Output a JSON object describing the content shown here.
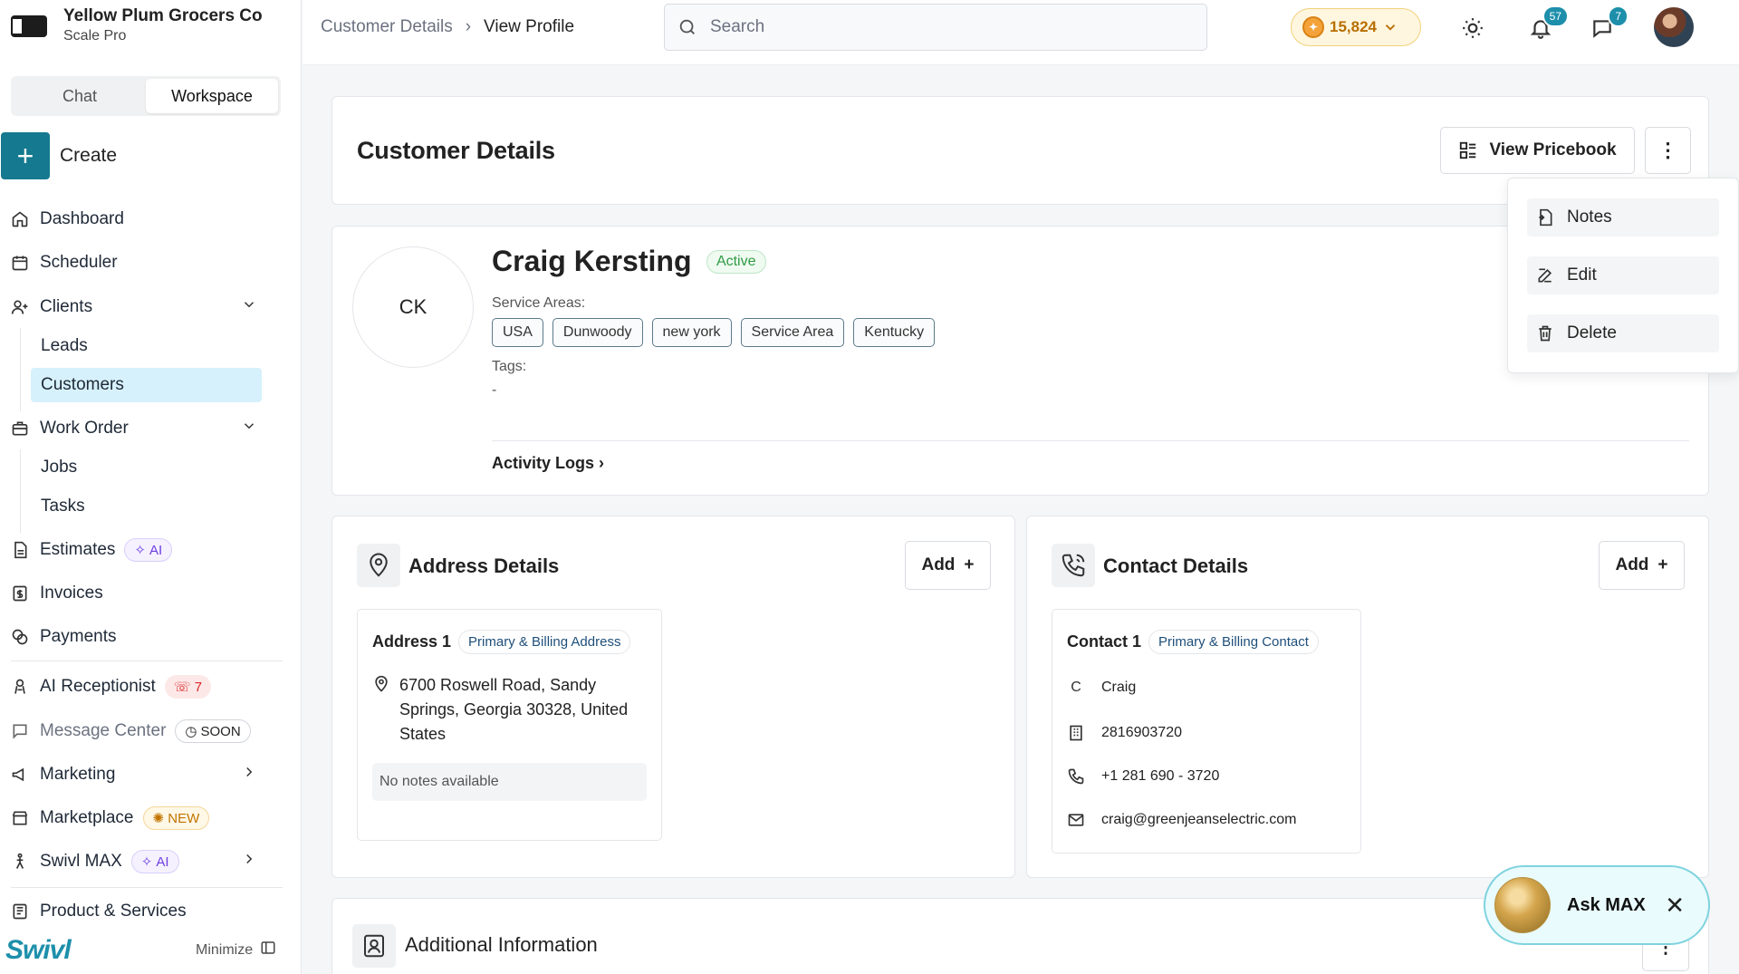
{
  "brand": {
    "name": "Yellow Plum Grocers Co",
    "plan": "Scale Pro"
  },
  "toggle": {
    "chat": "Chat",
    "workspace": "Workspace"
  },
  "create": "Create",
  "nav": {
    "dashboard": "Dashboard",
    "scheduler": "Scheduler",
    "clients": "Clients",
    "leads": "Leads",
    "customers": "Customers",
    "work_order": "Work Order",
    "jobs": "Jobs",
    "tasks": "Tasks",
    "estimates": "Estimates",
    "estimates_badge": "AI",
    "invoices": "Invoices",
    "payments": "Payments",
    "ai_receptionist": "AI Receptionist",
    "ai_receptionist_badge": "7",
    "message_center": "Message Center",
    "message_center_badge": "SOON",
    "marketing": "Marketing",
    "marketplace": "Marketplace",
    "marketplace_badge": "NEW",
    "swivl_max": "Swivl MAX",
    "swivl_max_badge": "AI",
    "product_services": "Product & Services"
  },
  "footer": {
    "logo": "Swivl",
    "minimize": "Minimize"
  },
  "breadcrumb": {
    "parent": "Customer Details",
    "current": "View Profile"
  },
  "search": {
    "placeholder": "Search"
  },
  "coins": "15,824",
  "notifications": "57",
  "messages": "7",
  "page": {
    "title": "Customer Details",
    "view_pricebook": "View Pricebook"
  },
  "menu": {
    "notes": "Notes",
    "edit": "Edit",
    "delete": "Delete"
  },
  "customer": {
    "initials": "CK",
    "name": "Craig Kersting",
    "status": "Active",
    "service_areas_label": "Service Areas:",
    "service_areas": [
      "USA",
      "Dunwoody",
      "new york",
      "Service Area",
      "Kentucky"
    ],
    "tags_label": "Tags:",
    "tags_value": "-",
    "activity_logs": "Activity Logs"
  },
  "address": {
    "title": "Address Details",
    "add": "Add",
    "card_title": "Address 1",
    "card_badge": "Primary & Billing Address",
    "line1": "6700 Roswell Road, Sandy",
    "line2": "Springs, Georgia 30328, United",
    "line3": "States",
    "notes": "No notes available"
  },
  "contact": {
    "title": "Contact Details",
    "add": "Add",
    "card_title": "Contact 1",
    "card_badge": "Primary & Billing Contact",
    "initial": "C",
    "name": "Craig",
    "office": "2816903720",
    "phone": "+1 281 690 - 3720",
    "email": "craig@greenjeanselectric.com"
  },
  "additional": {
    "title": "Additional Information"
  },
  "askmax": {
    "label": "Ask MAX"
  }
}
